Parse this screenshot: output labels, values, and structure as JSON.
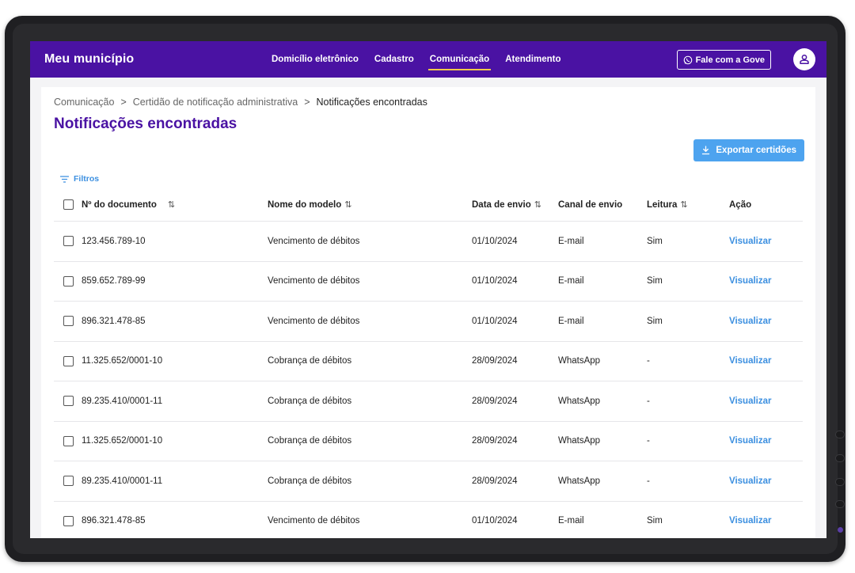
{
  "header": {
    "brand": "Meu município",
    "nav": [
      {
        "label": "Domicílio eletrônico",
        "active": false
      },
      {
        "label": "Cadastro",
        "active": false
      },
      {
        "label": "Comunicação",
        "active": true
      },
      {
        "label": "Atendimento",
        "active": false
      }
    ],
    "talk_button": "Fale com a Gove",
    "icons": {
      "whatsapp": "whatsapp-icon",
      "user": "user-icon"
    }
  },
  "breadcrumb": [
    "Comunicação",
    "Certidão de notificação administrativa",
    "Notificações encontradas"
  ],
  "page_title": "Notificações encontradas",
  "export_button": "Exportar certidões",
  "filters_label": "Filtros",
  "table": {
    "columns": [
      "Nº do documento",
      "Nome do modelo",
      "Data de envio",
      "Canal de envio",
      "Leitura",
      "Ação"
    ],
    "rows": [
      [
        "123.456.789-10",
        "Vencimento de débitos",
        "01/10/2024",
        "E-mail",
        "Sim",
        "Visualizar"
      ],
      [
        "859.652.789-99",
        "Vencimento de débitos",
        "01/10/2024",
        "E-mail",
        "Sim",
        "Visualizar"
      ],
      [
        "896.321.478-85",
        "Vencimento de débitos",
        "01/10/2024",
        "E-mail",
        "Sim",
        "Visualizar"
      ],
      [
        "11.325.652/0001-10",
        "Cobrança de débitos",
        "28/09/2024",
        "WhatsApp",
        "-",
        "Visualizar"
      ],
      [
        "89.235.410/0001-11",
        "Cobrança de débitos",
        "28/09/2024",
        "WhatsApp",
        "-",
        "Visualizar"
      ],
      [
        "11.325.652/0001-10",
        "Cobrança de débitos",
        "28/09/2024",
        "WhatsApp",
        "-",
        "Visualizar"
      ],
      [
        "89.235.410/0001-11",
        "Cobrança de débitos",
        "28/09/2024",
        "WhatsApp",
        "-",
        "Visualizar"
      ],
      [
        "896.321.478-85",
        "Vencimento de débitos",
        "01/10/2024",
        "E-mail",
        "Sim",
        "Visualizar"
      ]
    ]
  },
  "colors": {
    "primary": "#4a12a3",
    "accent": "#f2c94c",
    "link": "#3b8fe0",
    "button": "#4da3ef"
  }
}
